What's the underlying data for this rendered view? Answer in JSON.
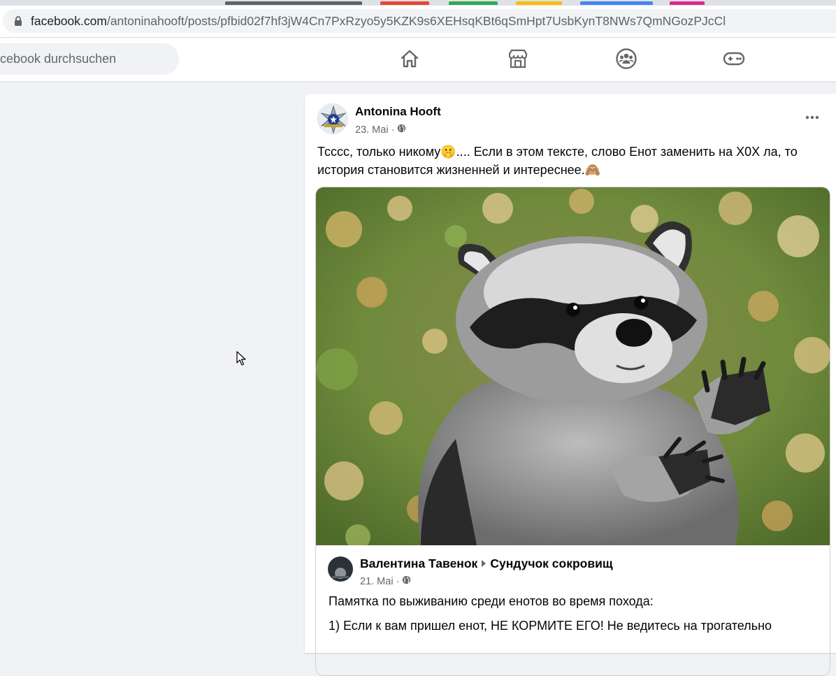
{
  "browser": {
    "url_domain": "facebook.com",
    "url_path": "/antoninahooft/posts/pfbid02f7hf3jW4Cn7PxRzyo5y5KZK9s6XEHsqKBt6qSmHpt7UsbKynT8NWs7QmNGozPJcCl",
    "tab_colors": [
      "#5f6368",
      "#ea4335",
      "#34a853",
      "#fbbc04",
      "#4285f4",
      "#e52592"
    ]
  },
  "fb_header": {
    "search_placeholder": "cebook durchsuchen",
    "nav_icons": [
      "home-icon",
      "marketplace-icon",
      "groups-icon",
      "gaming-icon"
    ]
  },
  "post": {
    "author": "Antonina Hooft",
    "date": "23. Mai",
    "separator": "·",
    "text": "Тсссс, только никому🤫.... Если в этом тексте, слово Енот заменить на Х0Х ла, то история становится жизненней и интереснее.🙈",
    "shared": {
      "author": "Валентина Тавенок",
      "group": "Сундучок сокровищ",
      "date": "21. Mai",
      "separator": "·",
      "line1": "Памятка по выживанию среди енотов во время похода:",
      "line2": "1) Если к вам пришел енот, НЕ КОРМИТЕ ЕГО! Не ведитесь на трогательно"
    }
  },
  "colors": {
    "fb_background": "#f0f2f5",
    "secondary_text": "#65676b",
    "icon_gray": "#65676b"
  }
}
